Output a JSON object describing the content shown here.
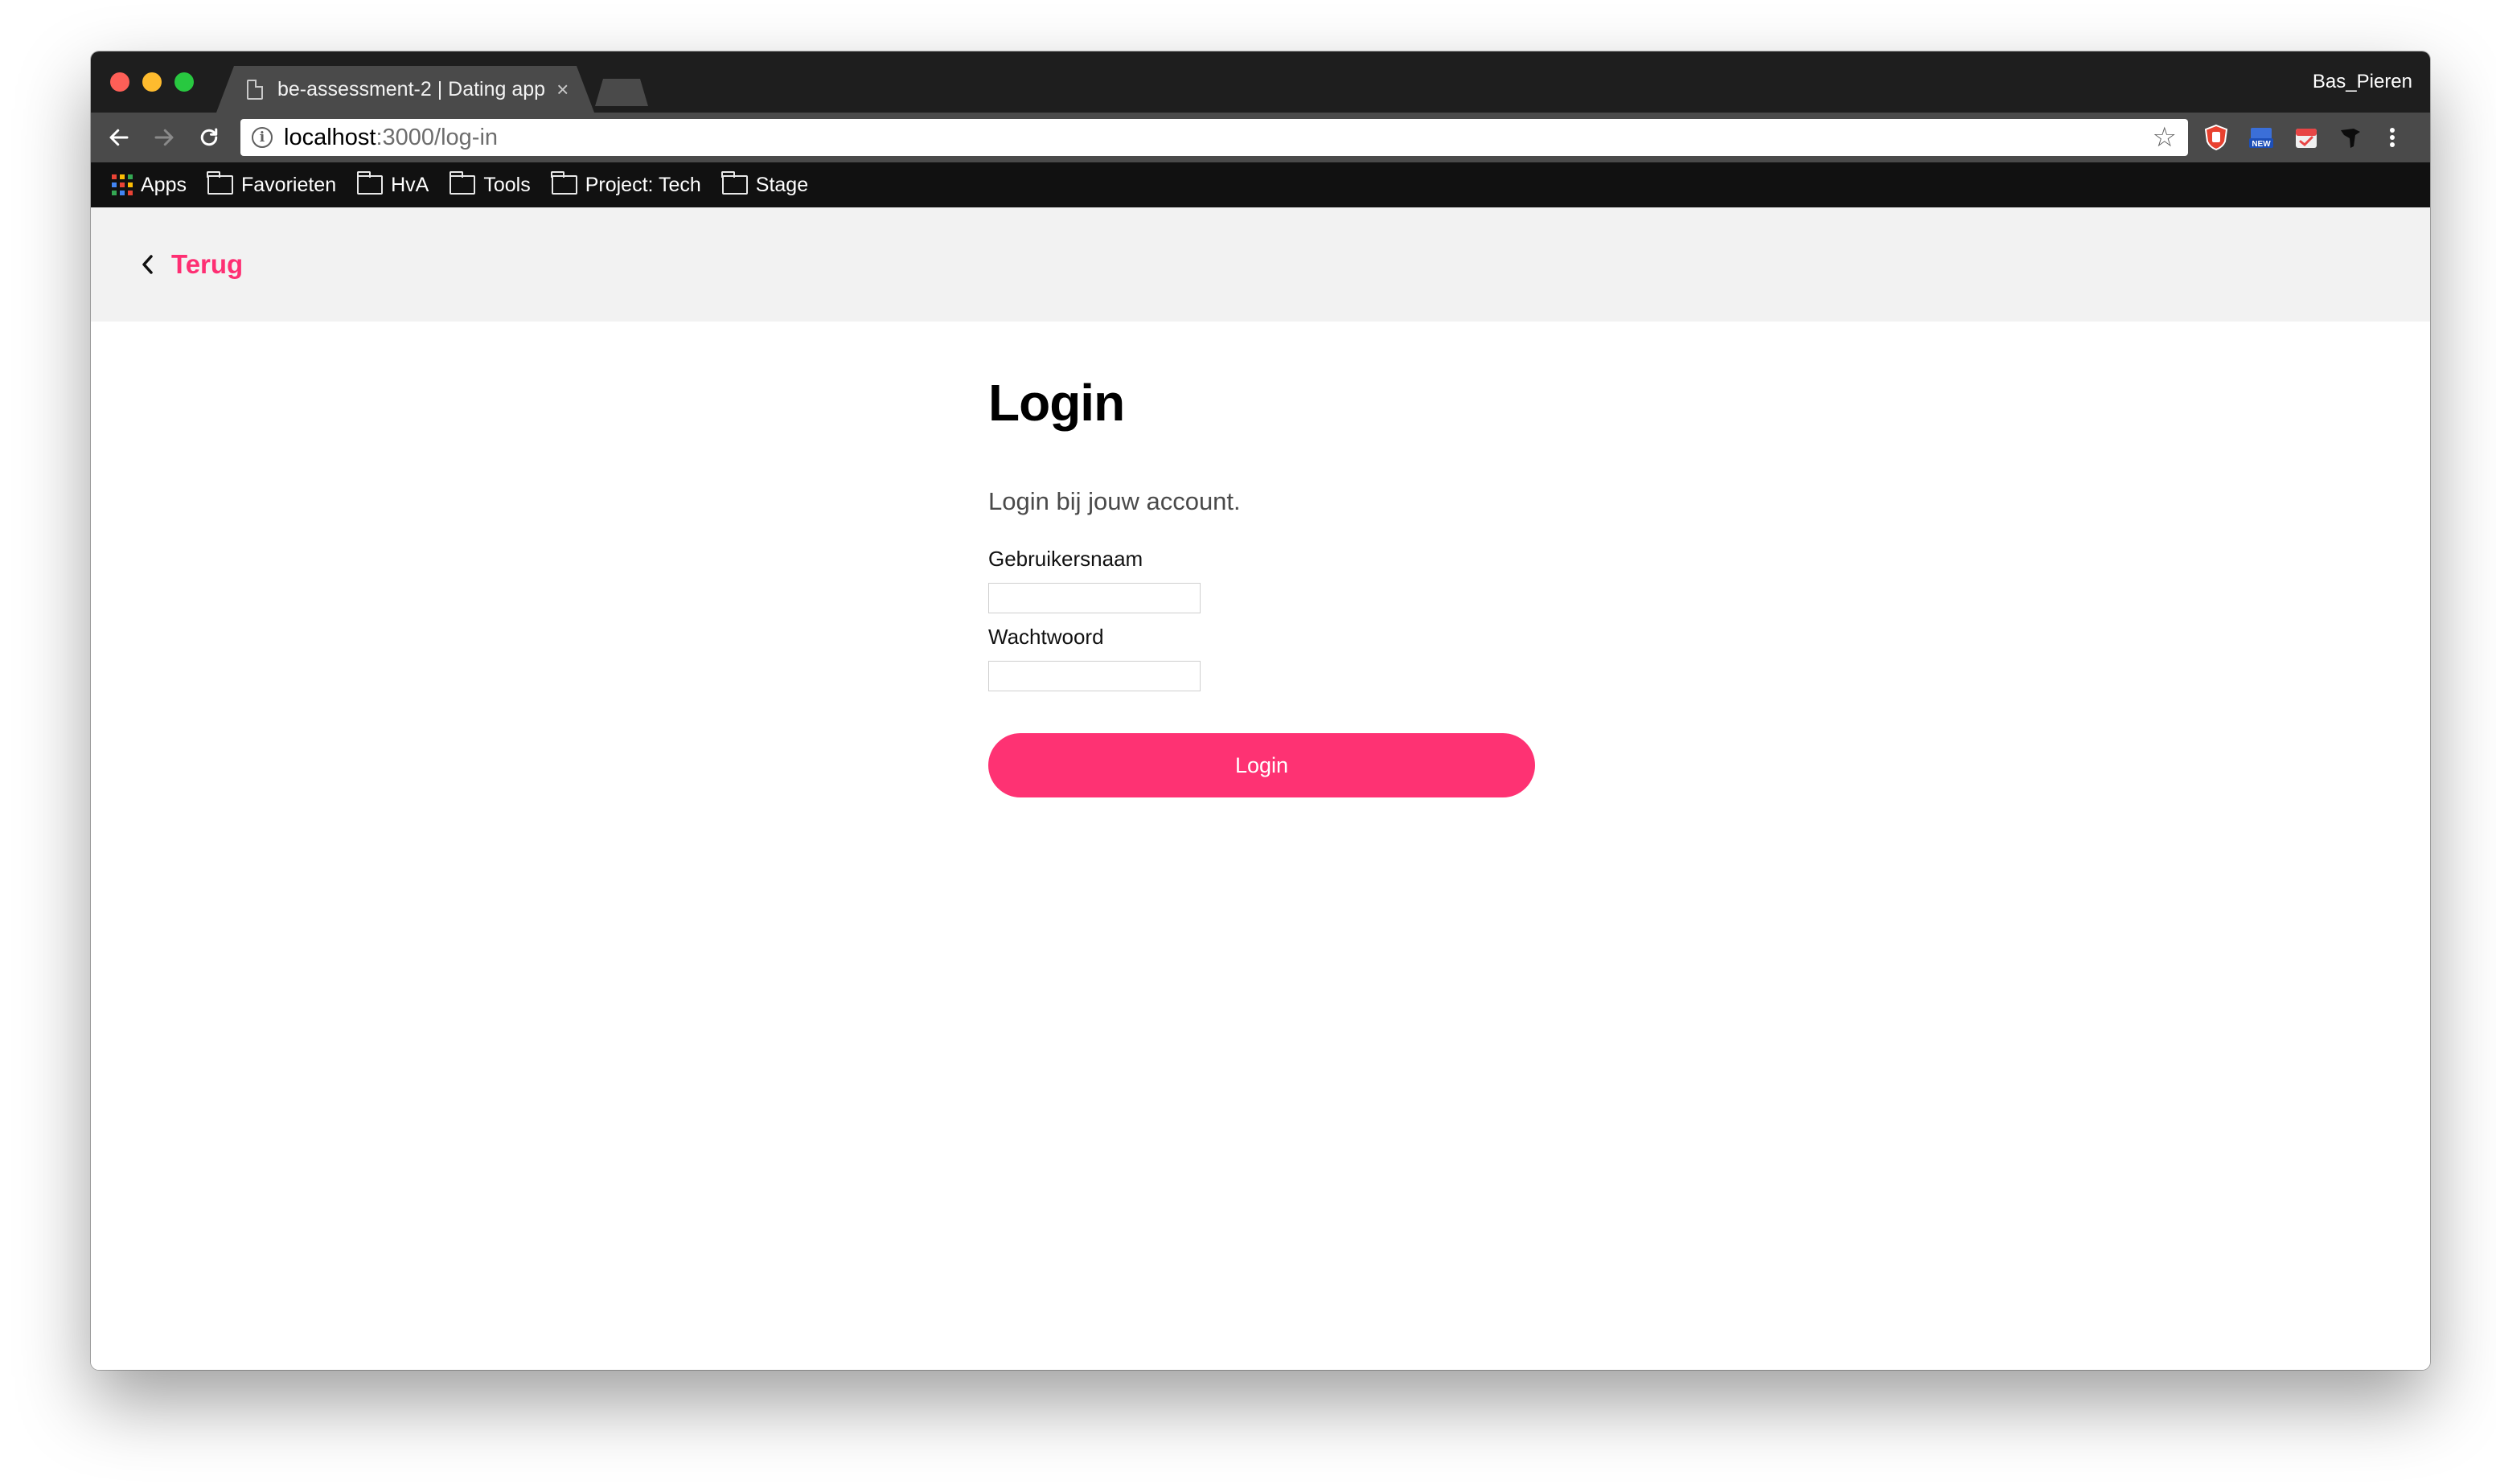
{
  "browser": {
    "tab_title": "be-assessment-2 | Dating app",
    "tab_close": "×",
    "profile_name": "Bas_Pieren",
    "url_host": "localhost",
    "url_rest": ":3000/log-in",
    "star_icon": "☆"
  },
  "bookmarks": [
    {
      "label": "Apps",
      "icon": "apps-grid-icon"
    },
    {
      "label": "Favorieten",
      "icon": "folder-icon"
    },
    {
      "label": "HvA",
      "icon": "folder-icon"
    },
    {
      "label": "Tools",
      "icon": "folder-icon"
    },
    {
      "label": "Project: Tech",
      "icon": "folder-icon"
    },
    {
      "label": "Stage",
      "icon": "folder-icon"
    }
  ],
  "page": {
    "back_label": "Terug",
    "title": "Login",
    "intro": "Login bij jouw account.",
    "username_label": "Gebruikersnaam",
    "username_value": "",
    "password_label": "Wachtwoord",
    "password_value": "",
    "submit_label": "Login"
  },
  "colors": {
    "accent": "#fe3273",
    "header_bg": "#f2f2f2"
  }
}
